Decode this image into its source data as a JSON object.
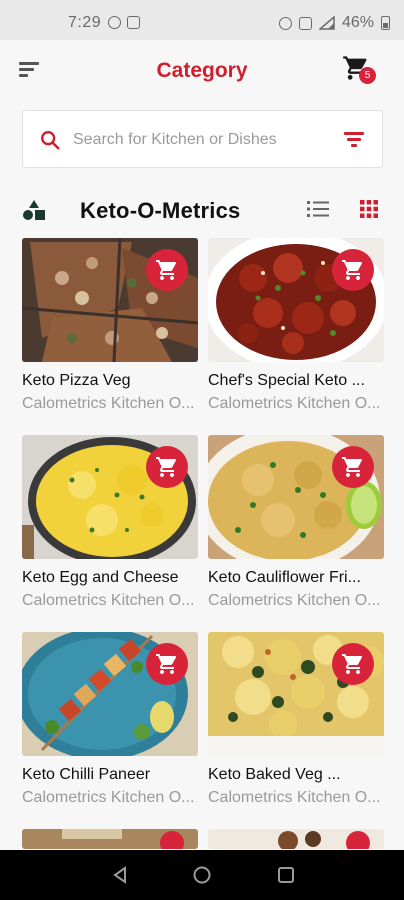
{
  "status_bar": {
    "time": "7:29",
    "battery": "46%",
    "icons": [
      "whatsapp-icon",
      "gallery-icon",
      "alarm-icon",
      "vibrate-icon",
      "signal-icon",
      "battery-icon"
    ]
  },
  "header": {
    "title": "Category",
    "cart_count": "5",
    "icons": [
      "menu-icon",
      "cart-icon"
    ]
  },
  "search": {
    "placeholder": "Search for Kitchen or Dishes",
    "icons": [
      "search-icon",
      "filter-icon"
    ]
  },
  "section": {
    "title": "Keto-O-Metrics",
    "icons": [
      "category-icon",
      "list-view-icon",
      "grid-view-icon"
    ]
  },
  "colors": {
    "accent": "#cf1f2e",
    "badge": "#d7243a",
    "muted_text": "#9a9a9a"
  },
  "dishes": [
    {
      "name": "Keto Pizza Veg",
      "kitchen": "Calometrics Kitchen O..."
    },
    {
      "name": "Chef's Special Keto ...",
      "kitchen": "Calometrics Kitchen O..."
    },
    {
      "name": "Keto Egg and Cheese",
      "kitchen": "Calometrics Kitchen O..."
    },
    {
      "name": "Keto Cauliflower Fri...",
      "kitchen": "Calometrics Kitchen O..."
    },
    {
      "name": "Keto Chilli Paneer",
      "kitchen": "Calometrics Kitchen O..."
    },
    {
      "name": "Keto Baked Veg ...",
      "kitchen": "Calometrics Kitchen O..."
    }
  ],
  "nav": {
    "icons": [
      "back-icon",
      "home-icon",
      "recents-icon"
    ]
  }
}
